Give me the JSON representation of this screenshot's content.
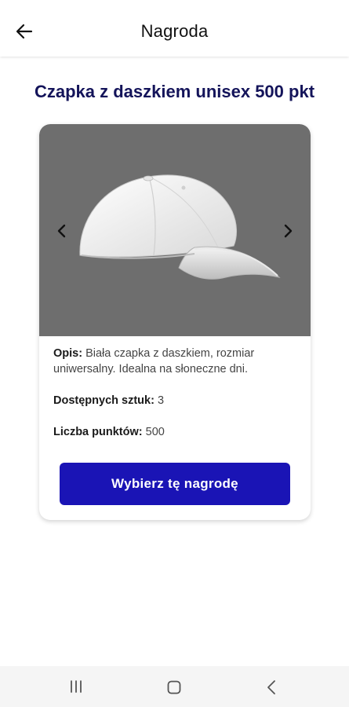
{
  "header": {
    "title": "Nagroda",
    "back_icon": "arrow-left-icon"
  },
  "reward": {
    "title": "Czapka z daszkiem unisex 500 pkt",
    "image_alt": "white-baseball-cap",
    "description_label": "Opis:",
    "description": "Biała czapka z daszkiem, rozmiar uniwersalny. Idealna na słoneczne dni.",
    "available_label": "Dostępnych sztuk:",
    "available_value": "3",
    "points_label": "Liczba punktów:",
    "points_value": "500",
    "choose_button": "Wybierz tę nagrodę"
  },
  "colors": {
    "accent": "#1a14b5",
    "title": "#14145a",
    "carousel_bg": "#6e6e6e"
  },
  "system_nav": {
    "recents": "recents-icon",
    "home": "home-icon",
    "back": "back-icon"
  }
}
